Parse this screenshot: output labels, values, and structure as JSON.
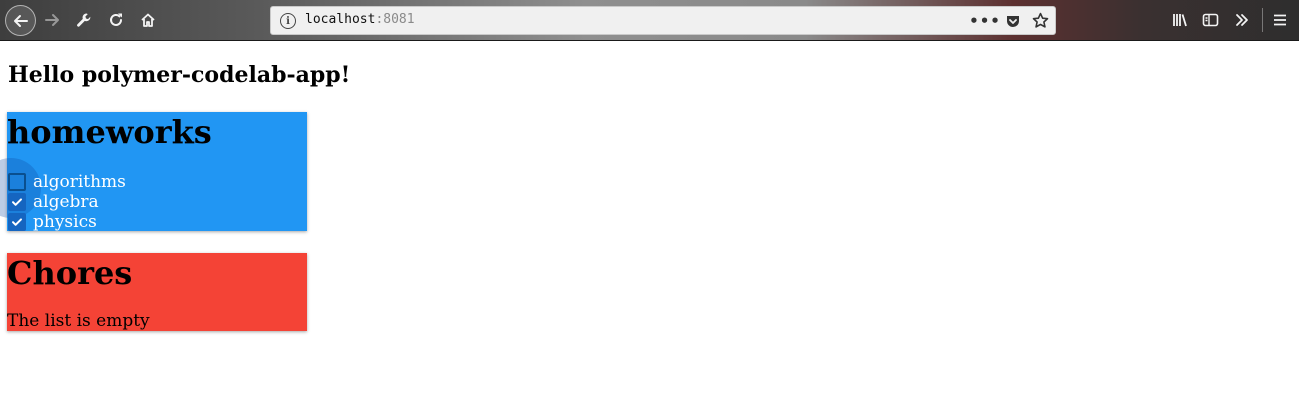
{
  "browser": {
    "back_icon": "arrow-left-icon",
    "forward_icon": "arrow-right-icon",
    "url_host": "localhost",
    "url_port": ":8081"
  },
  "page": {
    "title": "Hello polymer-codelab-app!"
  },
  "lists": [
    {
      "name": "homeworks",
      "color": "#2196f3",
      "items": [
        {
          "label": "algorithms",
          "checked": false
        },
        {
          "label": "algebra",
          "checked": true
        },
        {
          "label": "physics",
          "checked": true
        }
      ]
    },
    {
      "name": "Chores",
      "color": "#f44336",
      "empty_message": "The list is empty",
      "items": []
    }
  ]
}
